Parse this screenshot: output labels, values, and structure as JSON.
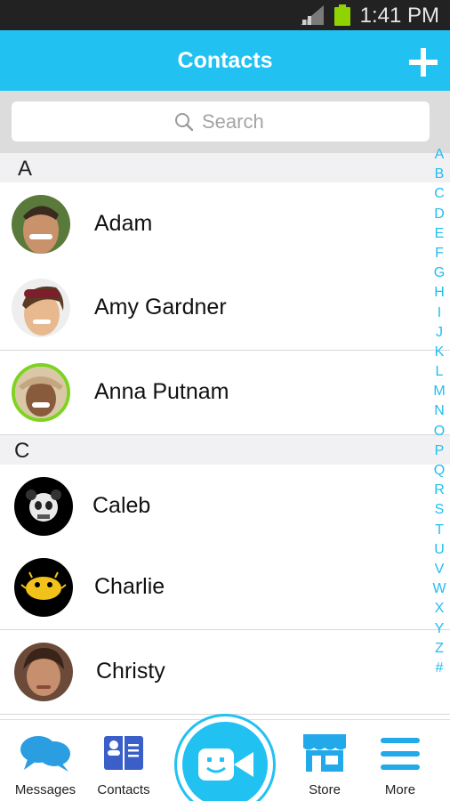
{
  "status_bar": {
    "time": "1:41 PM"
  },
  "header": {
    "title": "Contacts",
    "add_icon": "plus-icon"
  },
  "search": {
    "placeholder": "Search",
    "icon": "search-icon"
  },
  "sections": [
    {
      "letter": "A",
      "contacts": [
        "Adam",
        "Amy Gardner",
        "Anna Putnam"
      ]
    },
    {
      "letter": "C",
      "contacts": [
        "Caleb",
        "Charlie",
        "Christy"
      ]
    }
  ],
  "alphabet_index": [
    "A",
    "B",
    "C",
    "D",
    "E",
    "F",
    "G",
    "H",
    "I",
    "J",
    "K",
    "L",
    "M",
    "N",
    "O",
    "P",
    "Q",
    "R",
    "S",
    "T",
    "U",
    "V",
    "W",
    "X",
    "Y",
    "Z",
    "#"
  ],
  "bottom_nav": {
    "messages": "Messages",
    "contacts": "Contacts",
    "store": "Store",
    "more": "More"
  },
  "colors": {
    "accent": "#21c1f2",
    "battery": "#8fd400"
  }
}
